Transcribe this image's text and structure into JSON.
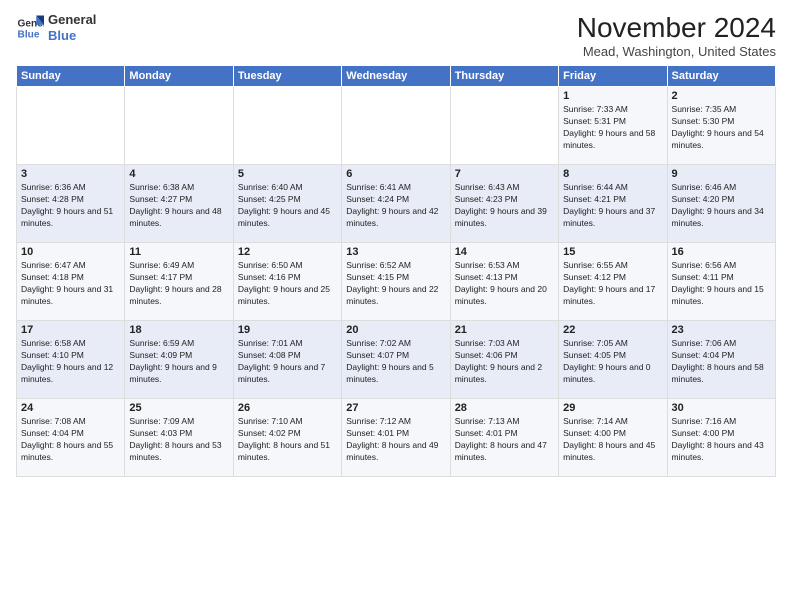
{
  "logo": {
    "line1": "General",
    "line2": "Blue"
  },
  "title": "November 2024",
  "subtitle": "Mead, Washington, United States",
  "headers": [
    "Sunday",
    "Monday",
    "Tuesday",
    "Wednesday",
    "Thursday",
    "Friday",
    "Saturday"
  ],
  "weeks": [
    [
      {
        "day": "",
        "sunrise": "",
        "sunset": "",
        "daylight": ""
      },
      {
        "day": "",
        "sunrise": "",
        "sunset": "",
        "daylight": ""
      },
      {
        "day": "",
        "sunrise": "",
        "sunset": "",
        "daylight": ""
      },
      {
        "day": "",
        "sunrise": "",
        "sunset": "",
        "daylight": ""
      },
      {
        "day": "",
        "sunrise": "",
        "sunset": "",
        "daylight": ""
      },
      {
        "day": "1",
        "sunrise": "Sunrise: 7:33 AM",
        "sunset": "Sunset: 5:31 PM",
        "daylight": "Daylight: 9 hours and 58 minutes."
      },
      {
        "day": "2",
        "sunrise": "Sunrise: 7:35 AM",
        "sunset": "Sunset: 5:30 PM",
        "daylight": "Daylight: 9 hours and 54 minutes."
      }
    ],
    [
      {
        "day": "3",
        "sunrise": "Sunrise: 6:36 AM",
        "sunset": "Sunset: 4:28 PM",
        "daylight": "Daylight: 9 hours and 51 minutes."
      },
      {
        "day": "4",
        "sunrise": "Sunrise: 6:38 AM",
        "sunset": "Sunset: 4:27 PM",
        "daylight": "Daylight: 9 hours and 48 minutes."
      },
      {
        "day": "5",
        "sunrise": "Sunrise: 6:40 AM",
        "sunset": "Sunset: 4:25 PM",
        "daylight": "Daylight: 9 hours and 45 minutes."
      },
      {
        "day": "6",
        "sunrise": "Sunrise: 6:41 AM",
        "sunset": "Sunset: 4:24 PM",
        "daylight": "Daylight: 9 hours and 42 minutes."
      },
      {
        "day": "7",
        "sunrise": "Sunrise: 6:43 AM",
        "sunset": "Sunset: 4:23 PM",
        "daylight": "Daylight: 9 hours and 39 minutes."
      },
      {
        "day": "8",
        "sunrise": "Sunrise: 6:44 AM",
        "sunset": "Sunset: 4:21 PM",
        "daylight": "Daylight: 9 hours and 37 minutes."
      },
      {
        "day": "9",
        "sunrise": "Sunrise: 6:46 AM",
        "sunset": "Sunset: 4:20 PM",
        "daylight": "Daylight: 9 hours and 34 minutes."
      }
    ],
    [
      {
        "day": "10",
        "sunrise": "Sunrise: 6:47 AM",
        "sunset": "Sunset: 4:18 PM",
        "daylight": "Daylight: 9 hours and 31 minutes."
      },
      {
        "day": "11",
        "sunrise": "Sunrise: 6:49 AM",
        "sunset": "Sunset: 4:17 PM",
        "daylight": "Daylight: 9 hours and 28 minutes."
      },
      {
        "day": "12",
        "sunrise": "Sunrise: 6:50 AM",
        "sunset": "Sunset: 4:16 PM",
        "daylight": "Daylight: 9 hours and 25 minutes."
      },
      {
        "day": "13",
        "sunrise": "Sunrise: 6:52 AM",
        "sunset": "Sunset: 4:15 PM",
        "daylight": "Daylight: 9 hours and 22 minutes."
      },
      {
        "day": "14",
        "sunrise": "Sunrise: 6:53 AM",
        "sunset": "Sunset: 4:13 PM",
        "daylight": "Daylight: 9 hours and 20 minutes."
      },
      {
        "day": "15",
        "sunrise": "Sunrise: 6:55 AM",
        "sunset": "Sunset: 4:12 PM",
        "daylight": "Daylight: 9 hours and 17 minutes."
      },
      {
        "day": "16",
        "sunrise": "Sunrise: 6:56 AM",
        "sunset": "Sunset: 4:11 PM",
        "daylight": "Daylight: 9 hours and 15 minutes."
      }
    ],
    [
      {
        "day": "17",
        "sunrise": "Sunrise: 6:58 AM",
        "sunset": "Sunset: 4:10 PM",
        "daylight": "Daylight: 9 hours and 12 minutes."
      },
      {
        "day": "18",
        "sunrise": "Sunrise: 6:59 AM",
        "sunset": "Sunset: 4:09 PM",
        "daylight": "Daylight: 9 hours and 9 minutes."
      },
      {
        "day": "19",
        "sunrise": "Sunrise: 7:01 AM",
        "sunset": "Sunset: 4:08 PM",
        "daylight": "Daylight: 9 hours and 7 minutes."
      },
      {
        "day": "20",
        "sunrise": "Sunrise: 7:02 AM",
        "sunset": "Sunset: 4:07 PM",
        "daylight": "Daylight: 9 hours and 5 minutes."
      },
      {
        "day": "21",
        "sunrise": "Sunrise: 7:03 AM",
        "sunset": "Sunset: 4:06 PM",
        "daylight": "Daylight: 9 hours and 2 minutes."
      },
      {
        "day": "22",
        "sunrise": "Sunrise: 7:05 AM",
        "sunset": "Sunset: 4:05 PM",
        "daylight": "Daylight: 9 hours and 0 minutes."
      },
      {
        "day": "23",
        "sunrise": "Sunrise: 7:06 AM",
        "sunset": "Sunset: 4:04 PM",
        "daylight": "Daylight: 8 hours and 58 minutes."
      }
    ],
    [
      {
        "day": "24",
        "sunrise": "Sunrise: 7:08 AM",
        "sunset": "Sunset: 4:04 PM",
        "daylight": "Daylight: 8 hours and 55 minutes."
      },
      {
        "day": "25",
        "sunrise": "Sunrise: 7:09 AM",
        "sunset": "Sunset: 4:03 PM",
        "daylight": "Daylight: 8 hours and 53 minutes."
      },
      {
        "day": "26",
        "sunrise": "Sunrise: 7:10 AM",
        "sunset": "Sunset: 4:02 PM",
        "daylight": "Daylight: 8 hours and 51 minutes."
      },
      {
        "day": "27",
        "sunrise": "Sunrise: 7:12 AM",
        "sunset": "Sunset: 4:01 PM",
        "daylight": "Daylight: 8 hours and 49 minutes."
      },
      {
        "day": "28",
        "sunrise": "Sunrise: 7:13 AM",
        "sunset": "Sunset: 4:01 PM",
        "daylight": "Daylight: 8 hours and 47 minutes."
      },
      {
        "day": "29",
        "sunrise": "Sunrise: 7:14 AM",
        "sunset": "Sunset: 4:00 PM",
        "daylight": "Daylight: 8 hours and 45 minutes."
      },
      {
        "day": "30",
        "sunrise": "Sunrise: 7:16 AM",
        "sunset": "Sunset: 4:00 PM",
        "daylight": "Daylight: 8 hours and 43 minutes."
      }
    ]
  ]
}
